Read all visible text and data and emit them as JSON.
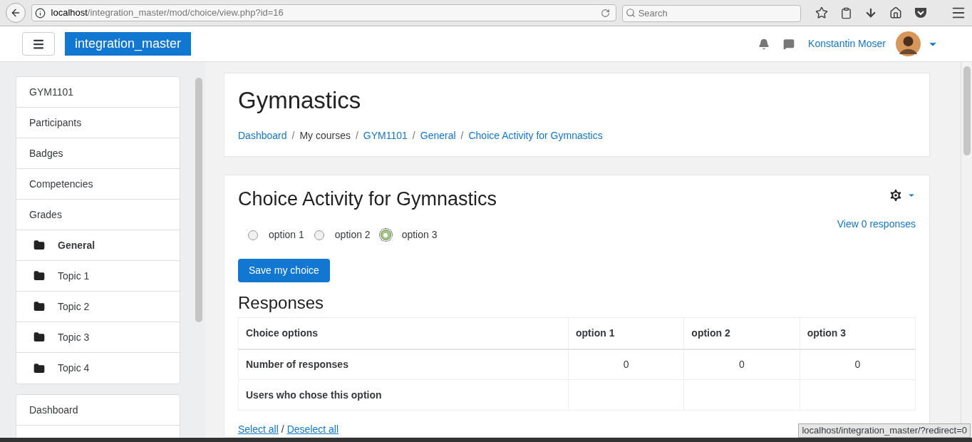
{
  "browser": {
    "url_host": "localhost",
    "url_path": "/integration_master/mod/choice/view.php?id=16",
    "search_placeholder": "Search"
  },
  "navbar": {
    "site_name": "integration_master",
    "user_name": "Konstantin Moser"
  },
  "sidebar": {
    "items": [
      {
        "label": "GYM1101",
        "kind": "link",
        "bold": false
      },
      {
        "label": "Participants",
        "kind": "link",
        "bold": false
      },
      {
        "label": "Badges",
        "kind": "link",
        "bold": false
      },
      {
        "label": "Competencies",
        "kind": "link",
        "bold": false
      },
      {
        "label": "Grades",
        "kind": "link",
        "bold": false
      },
      {
        "label": "General",
        "kind": "folder",
        "bold": true
      },
      {
        "label": "Topic 1",
        "kind": "folder",
        "bold": false
      },
      {
        "label": "Topic 2",
        "kind": "folder",
        "bold": false
      },
      {
        "label": "Topic 3",
        "kind": "folder",
        "bold": false
      },
      {
        "label": "Topic 4",
        "kind": "folder",
        "bold": false
      }
    ],
    "items2": [
      {
        "label": "Dashboard"
      }
    ]
  },
  "header": {
    "title": "Gymnastics",
    "breadcrumb": [
      {
        "label": "Dashboard",
        "link": true
      },
      {
        "separator": "/",
        "label": "My courses",
        "link": false
      },
      {
        "separator": "/",
        "label": "GYM1101",
        "link": true
      },
      {
        "separator": "/",
        "label": "General",
        "link": true
      },
      {
        "separator": "/",
        "label": "Choice Activity for Gymnastics",
        "link": true
      }
    ]
  },
  "activity": {
    "title": "Choice Activity for Gymnastics",
    "view_responses": "View 0 responses",
    "options": [
      {
        "label": "option 1",
        "selected": false
      },
      {
        "label": "option 2",
        "selected": false
      },
      {
        "label": "option 3",
        "selected": true
      }
    ],
    "save_button": "Save my choice",
    "responses_heading": "Responses",
    "table": {
      "columns": [
        "Choice options",
        "option 1",
        "option 2",
        "option 3"
      ],
      "rows": [
        {
          "cells": [
            "Number of responses",
            "0",
            "0",
            "0"
          ]
        },
        {
          "cells": [
            "Users who chose this option",
            "",
            "",
            ""
          ]
        }
      ]
    },
    "select_all": "Select all",
    "separator": "/",
    "deselect_all": "Deselect all"
  },
  "status_bar": {
    "text": "localhost/integration_master/?redirect=0"
  }
}
